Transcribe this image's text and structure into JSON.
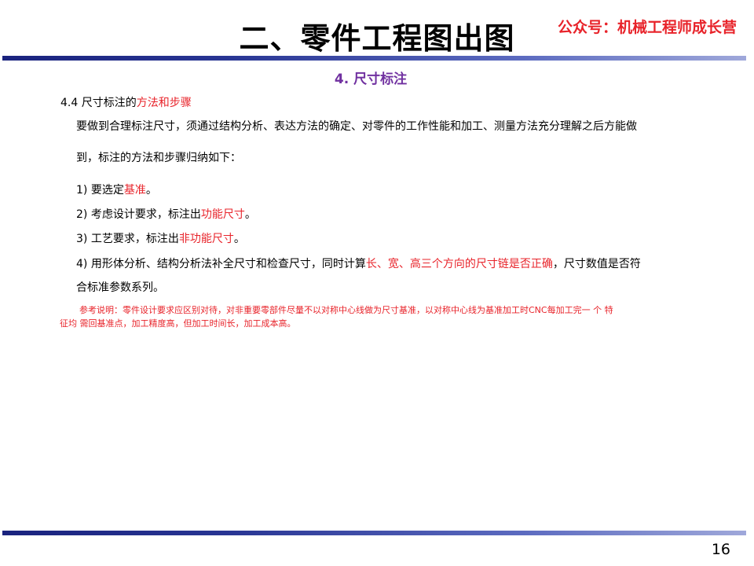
{
  "header": {
    "title": "二、零件工程图出图",
    "watermark": "公众号：机械工程师成长营"
  },
  "subtitle": "4. 尺寸标注",
  "section": {
    "number_text": "4.4 尺寸标注的",
    "highlight": "方法和步骤"
  },
  "intro": {
    "line1": "要做到合理标注尺寸，须通过结构分析、表达方法的确定、对零件的工作性能和加工、测量方法充分理解之后方能做",
    "line2": "到，标注的方法和步骤归纳如下："
  },
  "steps": [
    {
      "prefix": "1) 要选定",
      "highlight": "基准",
      "suffix": "。"
    },
    {
      "prefix": "2) 考虑设计要求，标注出",
      "highlight": "功能尺寸",
      "suffix": "。"
    },
    {
      "prefix": "3) 工艺要求，标注出",
      "highlight": "非功能尺寸",
      "suffix": "。"
    },
    {
      "prefix": "4) 用形体分析、结构分析法补全尺寸和检查尺寸，同时计算",
      "highlight": "长、宽、高三个方向的尺寸链是否正确",
      "suffix": "，尺寸数值是否符",
      "line2": "合标准参数系列。"
    }
  ],
  "note": {
    "line1": "参考说明：零件设计要求应区别对待，对非重要零部件尽量不以对称中心线做为尺寸基准，以对称中心线为基准加工时CNC每加工完一 个 特",
    "line2": "征均 需回基准点，加工精度高，但加工时间长，加工成本高。"
  },
  "footer": {
    "page_number": "16"
  },
  "colors": {
    "accent_red": "#e8232a",
    "subtitle_purple": "#7030a0",
    "rule_blue": "#1a237e"
  }
}
